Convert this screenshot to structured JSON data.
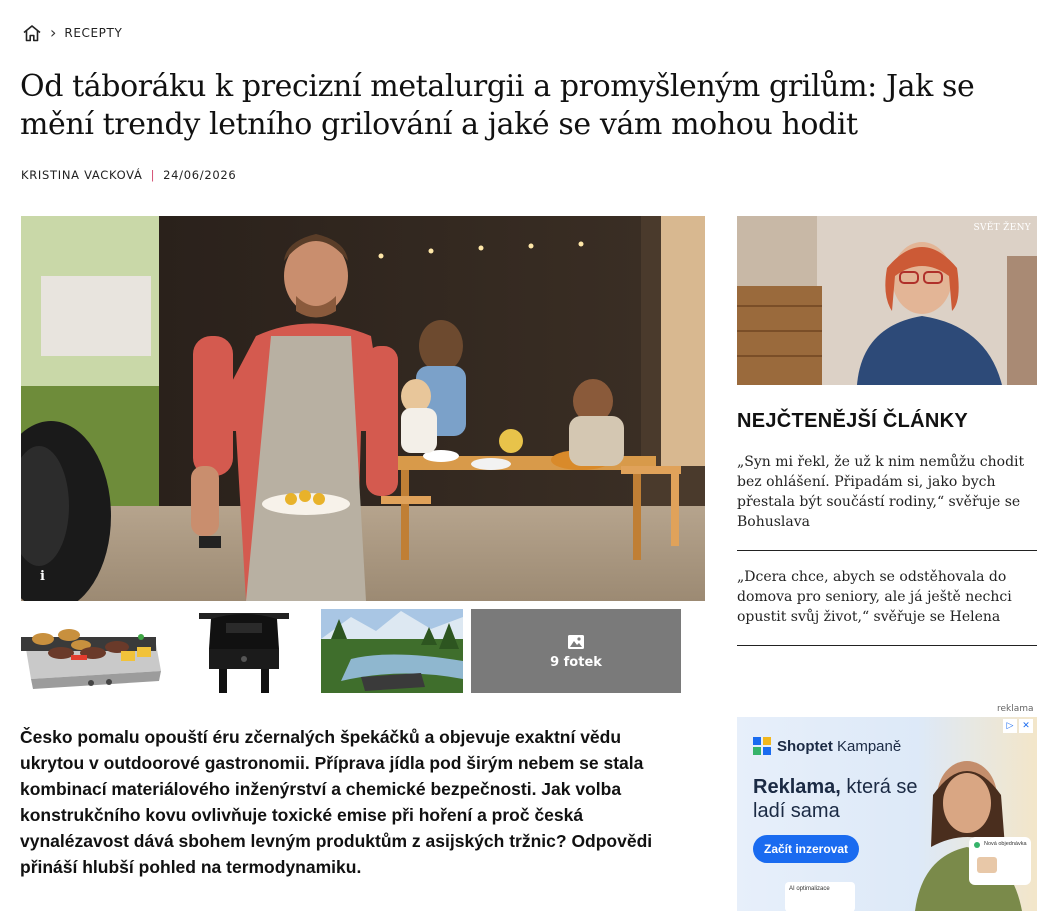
{
  "breadcrumb": {
    "home_icon": "home-icon",
    "section": "RECEPTY"
  },
  "article": {
    "title": "Od táboráku k precizní metalurgii a promyšleným grilům: Jak se mění trendy letního grilování a jaké se vám mohou hodit",
    "author": "KRISTINA VACKOVÁ",
    "separator": "|",
    "date": "24/06/2026",
    "hero_info": "i",
    "gallery_more_label": "9 fotek",
    "perex": "Česko pomalu opouští éru zčernalých špekáčků a objevuje exaktní vědu ukrytou v outdoorové gastronomii. Příprava jídla pod širým nebem se stala kombinací materiálového inženýrství a chemické bezpečnosti. Jak volba konstrukčního kovu ovlivňuje toxické emise při hoření a proč česká vynalézavost dává sbohem levným produktům z asijských tržnic? Odpovědi přináší hlubší pohled na termodynamiku."
  },
  "sidebar": {
    "video_brand": "SVĚT ŽENY",
    "most_read_heading": "NEJČTENĚJŠÍ ČLÁNKY",
    "most_read": [
      "„Syn mi řekl, že už k nim nemůžu chodit bez ohlášení. Připadám si, jako bych přestala být součástí rodiny,“ svěřuje se Bohuslava",
      "„Dcera chce, abych se odstěhovala do domova pro seniory, ale já ještě nechci opustit svůj život,“ svěřuje se Helena"
    ]
  },
  "ad": {
    "label": "reklama",
    "brand_bold": "Shoptet",
    "brand_rest": " Kampaně",
    "headline_bold": "Reklama,",
    "headline_rest": " která se ladí sama",
    "cta": "Začít inzerovat",
    "mini_label": "AI optimalizace",
    "mini_card": "Nová objednávka"
  },
  "colors": {
    "accent_pink": "#d24a6e",
    "cta_blue": "#1a6bf0"
  }
}
